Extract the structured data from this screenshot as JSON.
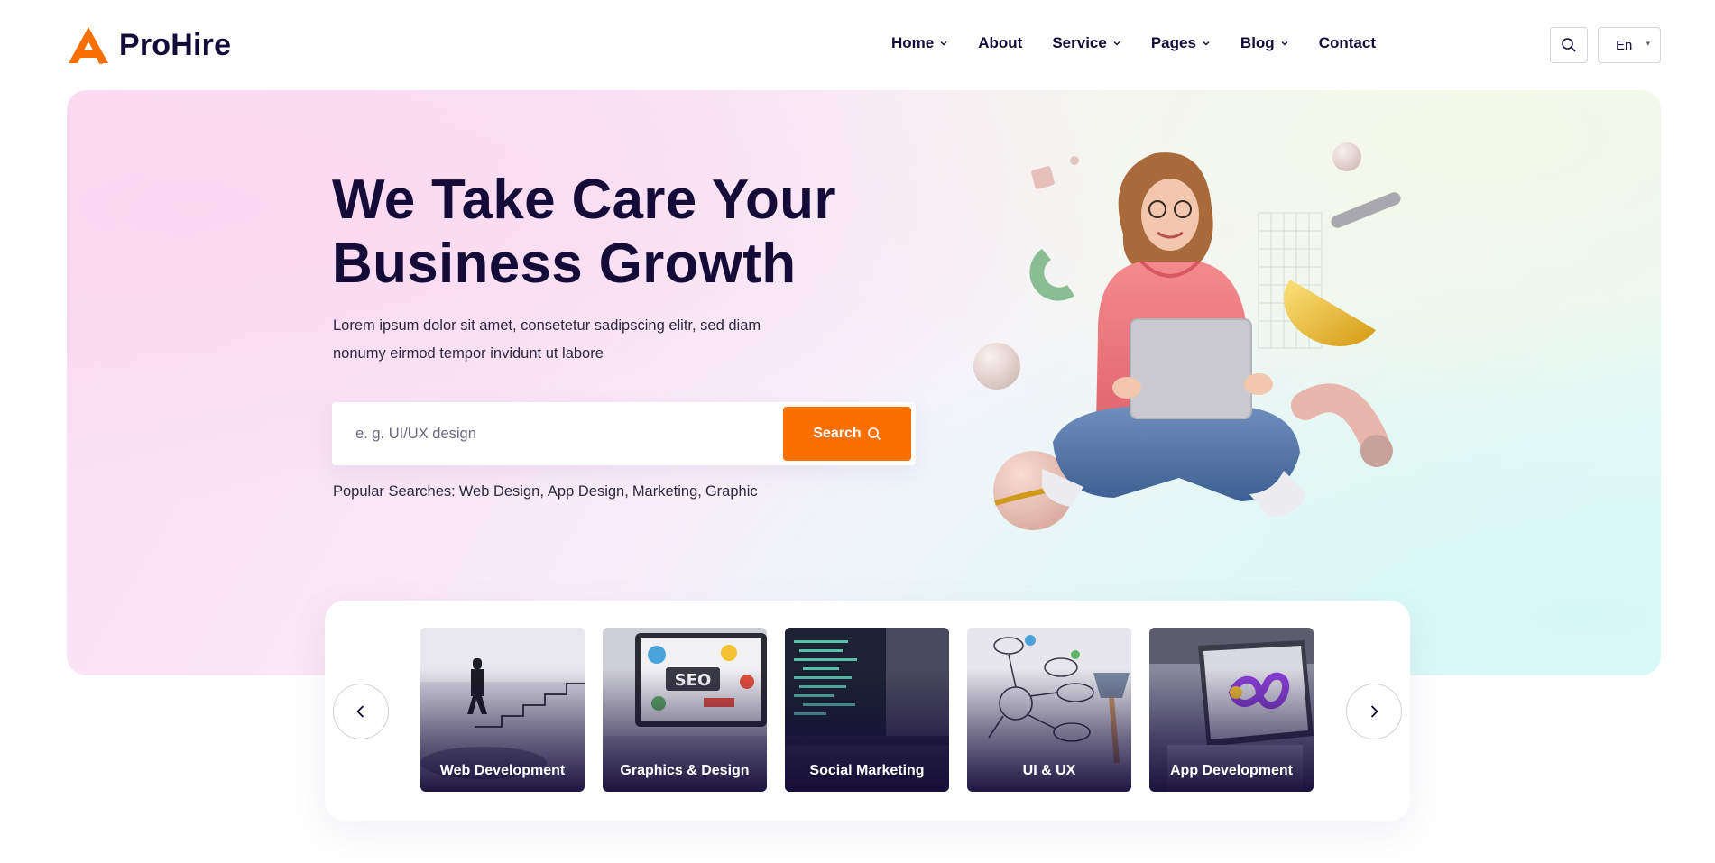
{
  "brand": {
    "name": "ProHire",
    "accent": "#f96f00",
    "dark": "#140b38"
  },
  "nav": [
    {
      "label": "Home",
      "dropdown": true
    },
    {
      "label": "About",
      "dropdown": false
    },
    {
      "label": "Service",
      "dropdown": true
    },
    {
      "label": "Pages",
      "dropdown": true
    },
    {
      "label": "Blog",
      "dropdown": true
    },
    {
      "label": "Contact",
      "dropdown": false
    }
  ],
  "header": {
    "search_icon": "search-icon",
    "language": "En"
  },
  "hero": {
    "title_line1": "We Take Care Your",
    "title_line2": "Business Growth",
    "description_line1": "Lorem ipsum dolor sit amet, consetetur sadipscing elitr, sed diam",
    "description_line2": "nonumy eirmod tempor invidunt ut labore",
    "search_placeholder": "e. g. UI/UX design",
    "search_button": "Search",
    "popular_label": "Popular Searches:",
    "popular_items": [
      "Web Design,",
      "App Design,",
      "Marketing,",
      "Graphic"
    ]
  },
  "categories": [
    {
      "label": "Web Development"
    },
    {
      "label": "Graphics & Design"
    },
    {
      "label": "Social Marketing"
    },
    {
      "label": "UI & UX"
    },
    {
      "label": "App Development"
    }
  ]
}
